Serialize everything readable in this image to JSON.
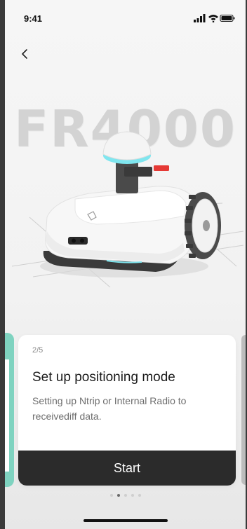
{
  "status_bar": {
    "time": "9:41",
    "icons": [
      "signal-icon",
      "wifi-icon",
      "battery-icon"
    ]
  },
  "nav": {
    "back_icon": "chevron-left-icon"
  },
  "hero": {
    "model_name": "FR4000"
  },
  "carousel": {
    "current_index": 1,
    "total": 5,
    "card": {
      "step": "2/5",
      "title": "Set up positioning mode",
      "description": "Setting up Ntrip or Internal Radio to receivediff data."
    },
    "start_label": "Start"
  },
  "colors": {
    "accent_teal": "#7fd3c0",
    "button_dark": "#2b2b2b",
    "robot_led": "#7fe6ef",
    "robot_badge": "#e53935"
  }
}
